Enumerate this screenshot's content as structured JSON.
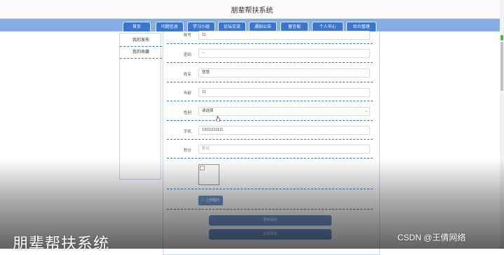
{
  "app": {
    "title": "朋辈帮扶系统"
  },
  "nav": {
    "items": [
      "首页",
      "问题信息",
      "学习小组",
      "论坛交流",
      "通知公告",
      "留言板",
      "个人中心",
      "后台管理"
    ]
  },
  "sidebar": {
    "items": [
      "我的发布",
      "我的收藏"
    ]
  },
  "form": {
    "fields": [
      {
        "label": "账号",
        "value": "11",
        "placeholder": ""
      },
      {
        "label": "密码",
        "value": "--",
        "placeholder": ""
      },
      {
        "label": "姓名",
        "value": "慧慧",
        "placeholder": ""
      },
      {
        "label": "年龄",
        "value": "11",
        "placeholder": ""
      },
      {
        "label": "性别",
        "value": "",
        "placeholder": "请选择"
      },
      {
        "label": "手机",
        "value": "13111111111",
        "placeholder": ""
      },
      {
        "label": "积分",
        "value": "",
        "placeholder": "积分"
      }
    ],
    "upload_label": "上传图片",
    "save_label": "更新信息",
    "logout_label": "退出登录"
  },
  "watermark": {
    "title": "朋辈帮扶系统",
    "credit": "CSDN @王倩网络"
  },
  "colors": {
    "nav_bg": "#86aee6",
    "nav_item": "#3a76d0",
    "button": "#6f93c8"
  }
}
